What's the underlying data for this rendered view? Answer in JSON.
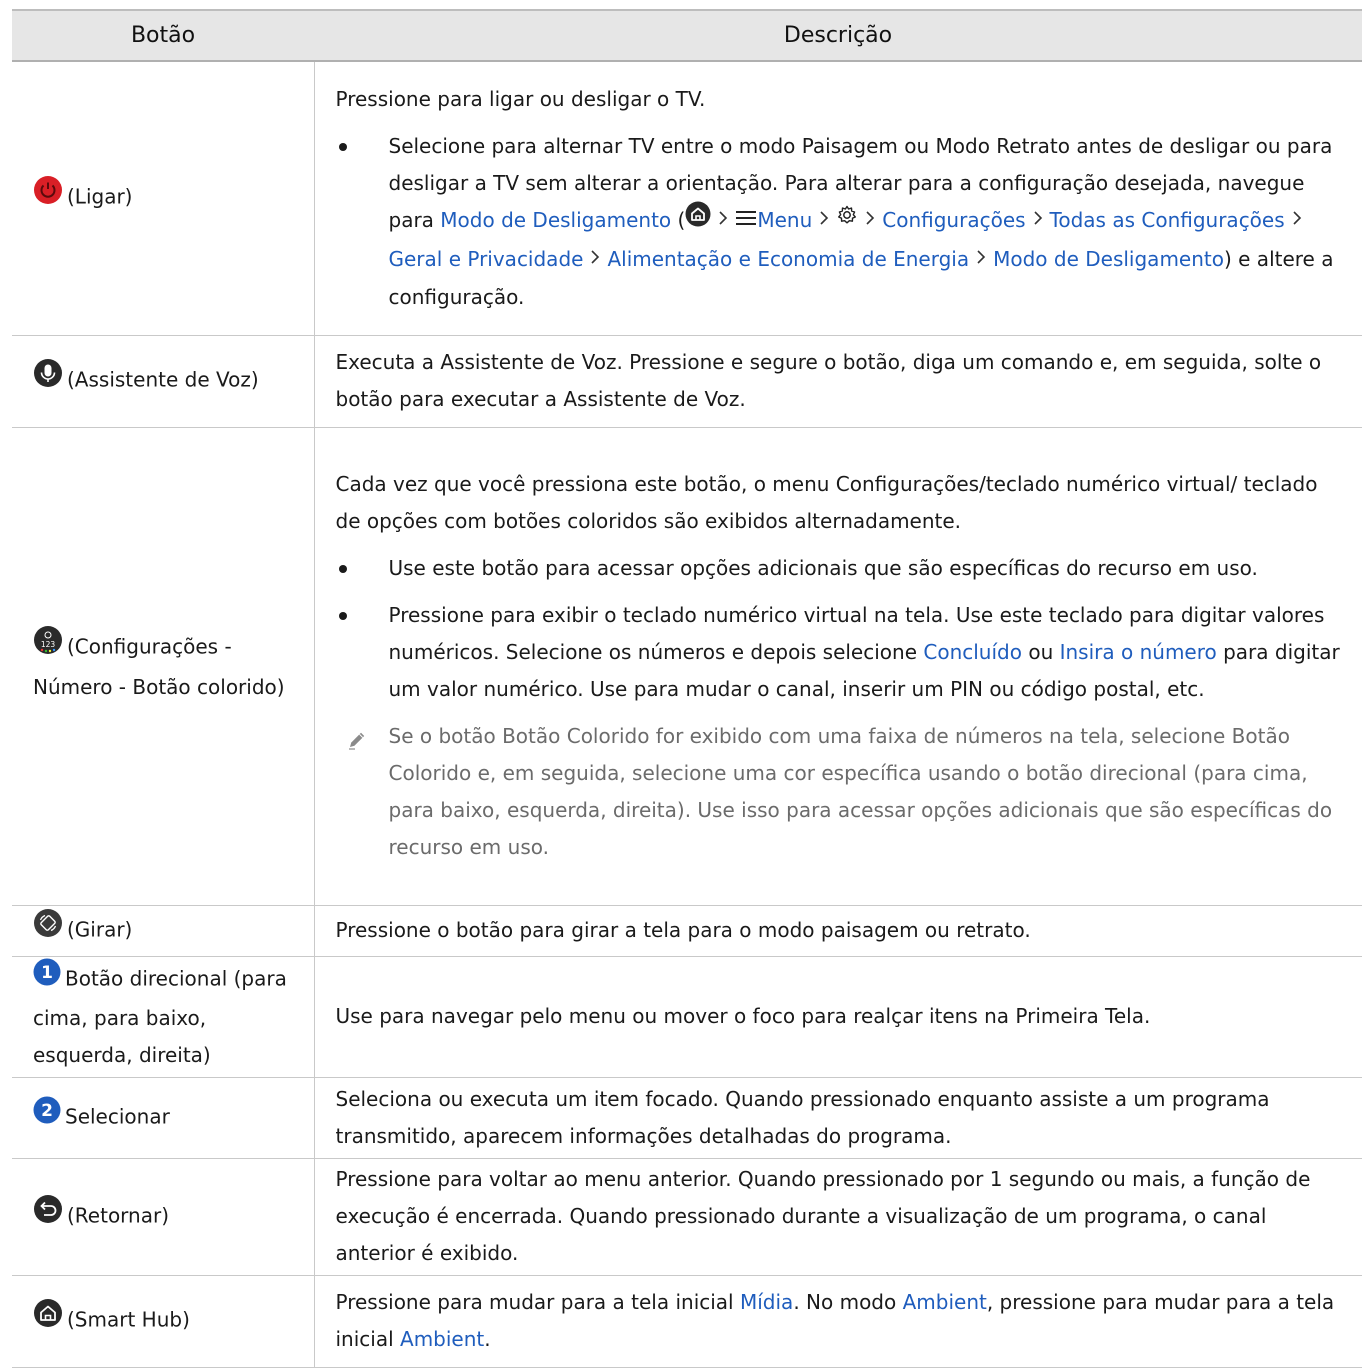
{
  "headers": {
    "col1": "Botão",
    "col2": "Descrição"
  },
  "rows": {
    "power": {
      "icon": "power-icon",
      "icon_color": "#d91f26",
      "label": "(Ligar)",
      "desc": "Pressione para ligar ou desligar o TV.",
      "bullet_before": "Selecione para alternar TV entre o modo Paisagem ou Modo Retrato antes de desligar ou para desligar a TV sem alterar a orientação. Para alterar para a configuração desejada, navegue para ",
      "link_mode": "Modo de Desligamento",
      "paren_open": " (",
      "menu": "Menu",
      "settings": "Configurações",
      "all_settings": "Todas as Configurações",
      "general": "Geral e Privacidade",
      "power_energy": "Alimentação e Economia de Energia",
      "mode_end": "Modo de Desligamento",
      "bullet_after": ") e altere a configuração."
    },
    "voice": {
      "icon": "microphone-icon",
      "label": "(Assistente de Voz)",
      "desc": "Executa a Assistente de Voz. Pressione e segure o botão, diga um comando e, em seguida, solte o botão para executar a Assistente de Voz."
    },
    "color": {
      "icon": "settings-123-icon",
      "label": "(Configurações - Número - Botão colorido)",
      "desc": "Cada vez que você pressiona este botão, o menu Configurações/teclado numérico virtual/ teclado de opções com botões coloridos são exibidos alternadamente.",
      "bullet1": "Use este botão para acessar opções adicionais que são específicas do recurso em uso.",
      "bullet2_a": "Pressione para exibir o teclado numérico virtual na tela. Use este teclado para digitar valores numéricos. Selecione os números e depois selecione ",
      "link_done": "Concluído",
      "bullet2_b": " ou ",
      "link_insert": "Insira o número",
      "bullet2_c": " para digitar um valor numérico. Use para mudar o canal, inserir um PIN ou código postal, etc.",
      "note": "Se o botão Botão Colorido for exibido com uma faixa de números na tela, selecione Botão Colorido e, em seguida, selecione uma cor específica usando o botão direcional (para cima, para baixo, esquerda, direita). Use isso para acessar opções adicionais que são específicas do recurso em uso."
    },
    "rotate": {
      "icon": "rotate-icon",
      "label": "(Girar)",
      "desc": "Pressione o botão para girar a tela para o modo paisagem ou retrato."
    },
    "directional": {
      "number": "1",
      "label": "Botão direcional (para cima, para baixo, esquerda, direita)",
      "desc": "Use para navegar pelo menu ou mover o foco para realçar itens na Primeira Tela."
    },
    "select": {
      "number": "2",
      "label": "Selecionar",
      "desc": "Seleciona ou executa um item focado. Quando pressionado enquanto assiste a um programa transmitido, aparecem informações detalhadas do programa."
    },
    "return": {
      "icon": "return-icon",
      "label": "(Retornar)",
      "desc": "Pressione para voltar ao menu anterior. Quando pressionado por 1 segundo ou mais, a função de execução é encerrada. Quando pressionado durante a visualização de um programa, o canal anterior é exibido."
    },
    "smarthub": {
      "icon": "home-icon",
      "label": "(Smart Hub)",
      "desc_a": "Pressione para mudar para a tela inicial ",
      "link_media": "Mídia",
      "desc_b": ". No modo ",
      "link_ambient": "Ambient",
      "desc_c": ", pressione para mudar para a tela inicial ",
      "link_ambient2": "Ambient",
      "desc_d": "."
    }
  },
  "colors": {
    "link": "#1f5dbd",
    "header_bg": "#e6e6e6",
    "note_text": "#6b6b6b",
    "number_badge": "#1f5dbd"
  }
}
